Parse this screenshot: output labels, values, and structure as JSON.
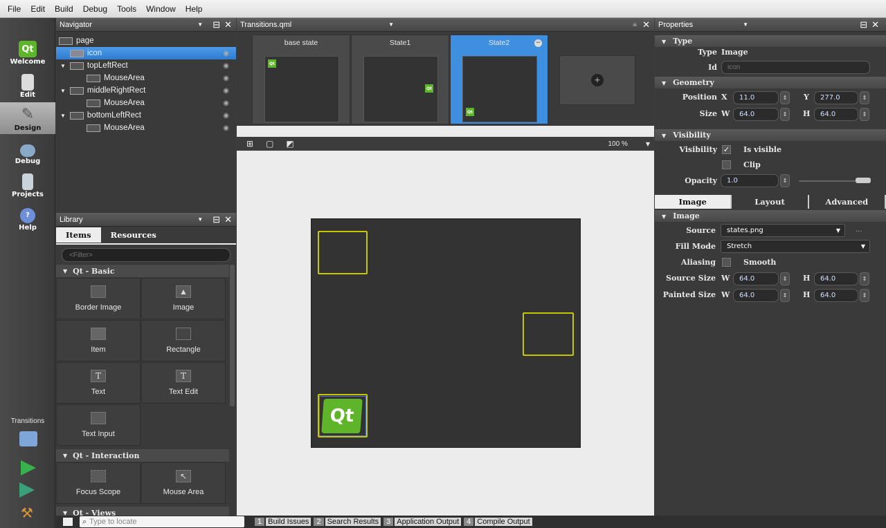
{
  "menu": [
    "File",
    "Edit",
    "Build",
    "Debug",
    "Tools",
    "Window",
    "Help"
  ],
  "modes": [
    {
      "label": "Welcome",
      "icon": "qt-logo-icon"
    },
    {
      "label": "Edit",
      "icon": "edit-document-icon"
    },
    {
      "label": "Design",
      "icon": "design-icon"
    },
    {
      "label": "Debug",
      "icon": "debug-bug-icon"
    },
    {
      "label": "Projects",
      "icon": "projects-icon"
    },
    {
      "label": "Help",
      "icon": "help-icon"
    }
  ],
  "transitions_label": "Transitions",
  "navigator": {
    "title": "Navigator",
    "items": [
      {
        "label": "page"
      },
      {
        "label": "icon"
      },
      {
        "label": "topLeftRect"
      },
      {
        "label": "MouseArea"
      },
      {
        "label": "middleRightRect"
      },
      {
        "label": "MouseArea"
      },
      {
        "label": "bottomLeftRect"
      },
      {
        "label": "MouseArea"
      }
    ]
  },
  "library": {
    "title": "Library",
    "tabs": [
      "Items",
      "Resources"
    ],
    "filter_placeholder": "<Filter>",
    "categories": [
      "Qt - Basic",
      "Qt - Interaction",
      "Qt - Views"
    ],
    "basic_items": [
      "Border Image",
      "Image",
      "Item",
      "Rectangle",
      "Text",
      "Text Edit",
      "Text Input"
    ],
    "interaction_items": [
      "Focus Scope",
      "Mouse Area"
    ]
  },
  "editor": {
    "file": "Transitions.qml",
    "states": [
      "base state",
      "State1",
      "State2"
    ],
    "zoom": "100 %"
  },
  "properties": {
    "title": "Properties",
    "sections": {
      "type": "Type",
      "geometry": "Geometry",
      "visibility": "Visibility",
      "image": "Image"
    },
    "type_label": "Type",
    "type_value": "Image",
    "id_label": "Id",
    "id_placeholder": "icon",
    "position_label": "Position",
    "size_label": "Size",
    "x_label": "X",
    "y_label": "Y",
    "w_label": "W",
    "h_label": "H",
    "pos_x": "11.0",
    "pos_y": "277.0",
    "size_w": "64.0",
    "size_h": "64.0",
    "visibility_label": "Visibility",
    "is_visible": "Is visible",
    "clip": "Clip",
    "opacity_label": "Opacity",
    "opacity": "1.0",
    "tabs": [
      "Image",
      "Layout",
      "Advanced"
    ],
    "source_label": "Source",
    "source": "states.png",
    "more": "...",
    "fill_mode_label": "Fill Mode",
    "fill_mode": "Stretch",
    "aliasing_label": "Aliasing",
    "smooth": "Smooth",
    "source_size_label": "Source Size",
    "painted_size_label": "Painted Size",
    "source_w": "64.0",
    "source_h": "64.0",
    "painted_w": "64.0",
    "painted_h": "64.0"
  },
  "locator_placeholder": "Type to locate",
  "output_tabs": [
    {
      "n": "1",
      "label": "Build Issues"
    },
    {
      "n": "2",
      "label": "Search Results"
    },
    {
      "n": "3",
      "label": "Application Output"
    },
    {
      "n": "4",
      "label": "Compile Output"
    }
  ],
  "colors": {
    "selection": "#2f7cd0",
    "qt_green": "#5fb52a",
    "rect_border": "#c8c800"
  }
}
